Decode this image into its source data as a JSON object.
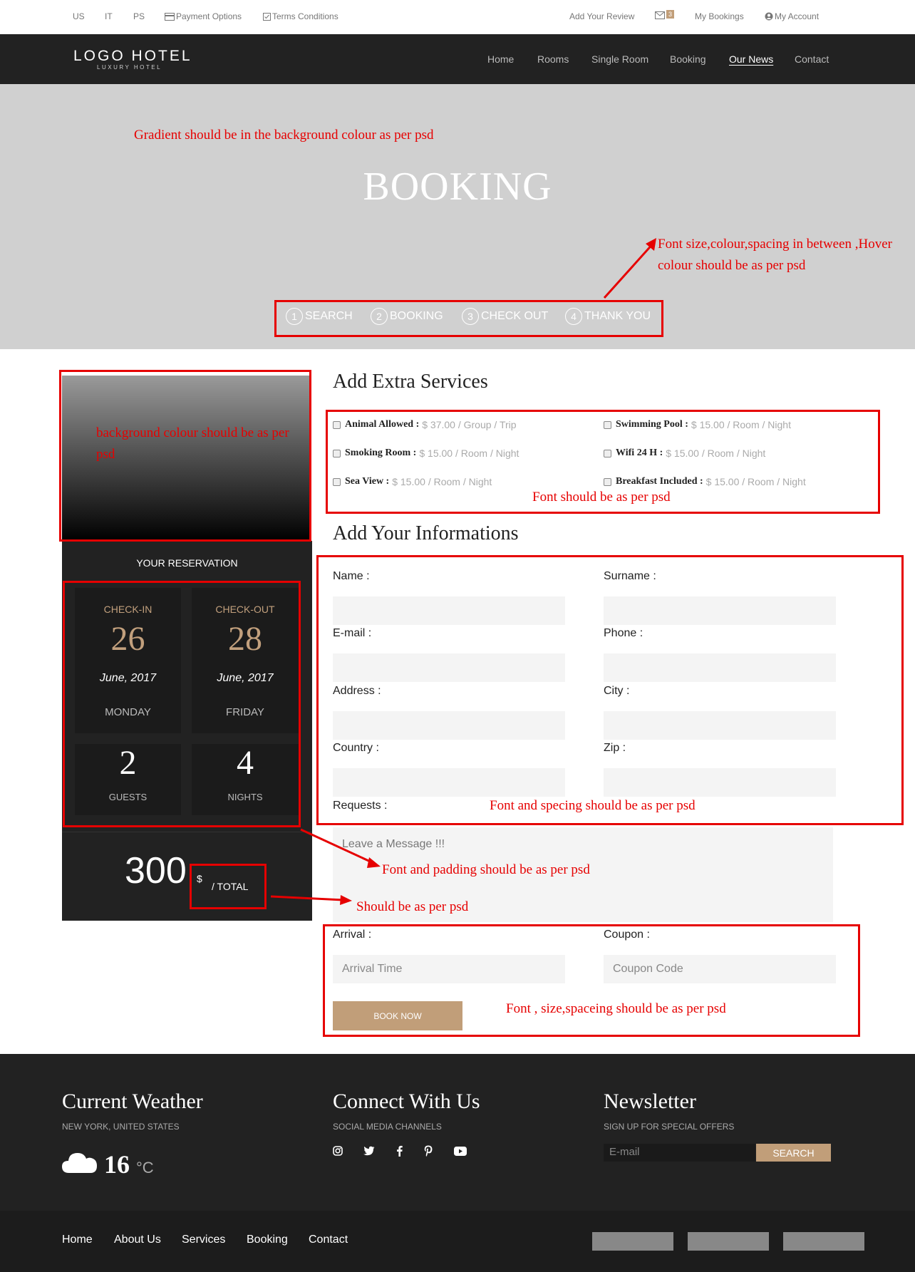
{
  "topbar": {
    "lang_us": "US",
    "lang_it": "IT",
    "lang_ps": "PS",
    "payment": "Payment Options",
    "terms": "Terms Conditions",
    "add_review": "Add Your Review",
    "mail_count": "3",
    "my_bookings": "My Bookings",
    "my_account": "My Account"
  },
  "nav": {
    "logo": "LOGO HOTEL",
    "logo_sub": "LUXURY HOTEL",
    "items": [
      "Home",
      "Rooms",
      "Single Room",
      "Booking",
      "Our News",
      "Contact"
    ],
    "active": "Our News"
  },
  "hero": {
    "title": "BOOKING",
    "steps": [
      {
        "num": "1",
        "label": "SEARCH"
      },
      {
        "num": "2",
        "label": "BOOKING"
      },
      {
        "num": "3",
        "label": "CHECK OUT"
      },
      {
        "num": "4",
        "label": "THANK YOU"
      }
    ]
  },
  "annotations": {
    "gradient": "Gradient should be in the background colour as per psd",
    "steps_line1": "Font size,colour,spacing in between ,Hover",
    "steps_line2": "colour should be as per psd",
    "sidebar_bg_line1": "background colour should be as per",
    "sidebar_bg_line2": "psd",
    "services_font": "Font should be as per psd",
    "form_font": "Font and specing should be as per psd",
    "message_font": "Font and padding should be as per psd",
    "total_font": "Should be as per psd",
    "bottom_font": "Font , size,spaceing should be as per psd"
  },
  "reservation": {
    "title": "YOUR RESERVATION",
    "checkin_label": "CHECK-IN",
    "checkin_day": "26",
    "checkin_month": "June, 2017",
    "checkin_weekday": "MONDAY",
    "checkout_label": "CHECK-OUT",
    "checkout_day": "28",
    "checkout_month": "June, 2017",
    "checkout_weekday": "FRIDAY",
    "guests_num": "2",
    "guests_label": "GUESTS",
    "nights_num": "4",
    "nights_label": "NIGHTS",
    "total": "300",
    "currency": "$",
    "total_label": "/ TOTAL"
  },
  "services": {
    "title": "Add Extra Services",
    "items": [
      {
        "name": "Animal Allowed :",
        "price": "$ 37.00 / Group / Trip"
      },
      {
        "name": "Swimming Pool :",
        "price": "$ 15.00 / Room / Night"
      },
      {
        "name": "Smoking Room :",
        "price": "$ 15.00 / Room / Night"
      },
      {
        "name": "Wifi 24 H :",
        "price": "$ 15.00 / Room / Night"
      },
      {
        "name": "Sea View :",
        "price": "$ 15.00 / Room / Night"
      },
      {
        "name": "Breakfast Included :",
        "price": "$ 15.00 / Room / Night"
      }
    ]
  },
  "info": {
    "title": "Add Your Informations",
    "name": "Name :",
    "surname": "Surname :",
    "email": "E-mail :",
    "phone": "Phone :",
    "address": "Address :",
    "city": "City :",
    "country": "Country :",
    "zip": "Zip :",
    "requests": "Requests :",
    "message_placeholder": "Leave a Message !!!",
    "arrival": "Arrival :",
    "coupon": "Coupon :",
    "arrival_placeholder": "Arrival Time",
    "coupon_placeholder": "Coupon Code",
    "book_now": "BOOK NOW"
  },
  "footer": {
    "weather_title": "Current Weather",
    "weather_sub": "NEW YORK, UNITED STATES",
    "temp": "16",
    "temp_unit": "°C",
    "connect_title": "Connect With Us",
    "connect_sub": "SOCIAL MEDIA CHANNELS",
    "social_icons": [
      "instagram-icon",
      "twitter-icon",
      "facebook-icon",
      "pinterest-icon",
      "youtube-icon"
    ],
    "newsletter_title": "Newsletter",
    "newsletter_sub": "SIGN UP FOR SPECIAL OFFERS",
    "email_placeholder": "E-mail",
    "search_button": "SEARCH",
    "links": [
      "Home",
      "About Us",
      "Services",
      "Booking",
      "Contact"
    ]
  },
  "colors": {
    "accent": "#c19e79",
    "dark": "#222222",
    "hero_bg": "#d0d0d0",
    "annotation": "#e60000"
  }
}
